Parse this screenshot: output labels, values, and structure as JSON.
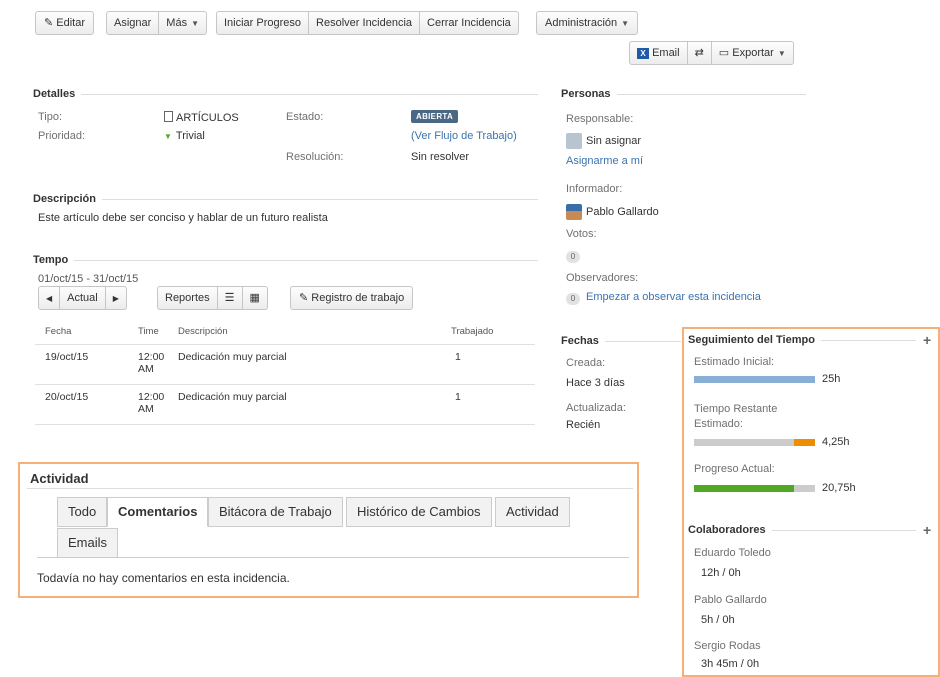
{
  "toolbar": {
    "edit": "Editar",
    "assign": "Asignar",
    "more": "Más",
    "start_progress": "Iniciar Progreso",
    "resolve": "Resolver Incidencia",
    "close": "Cerrar Incidencia",
    "admin": "Administración",
    "email": "Email",
    "export": "Exportar"
  },
  "details": {
    "title": "Detalles",
    "type_label": "Tipo:",
    "type_value": "ARTÍCULOS",
    "priority_label": "Prioridad:",
    "priority_value": "Trivial",
    "status_label": "Estado:",
    "status_value": "ABIERTA",
    "workflow_link": "(Ver Flujo de Trabajo)",
    "resolution_label": "Resolución:",
    "resolution_value": "Sin resolver"
  },
  "description": {
    "title": "Descripción",
    "text": "Este artículo debe ser conciso y hablar de un futuro realista"
  },
  "time": {
    "title": "Tempo",
    "range": "01/oct/15 - 31/oct/15",
    "current": "Actual",
    "reports": "Reportes",
    "worklog_button": "Registro de trabajo",
    "headers": [
      "Fecha",
      "Time",
      "Descripción",
      "Trabajado"
    ],
    "rows": [
      {
        "date": "19/oct/15",
        "time": "12:00 AM",
        "desc": "Dedicación muy parcial",
        "worked": "1"
      },
      {
        "date": "20/oct/15",
        "time": "12:00 AM",
        "desc": "Dedicación muy parcial",
        "worked": "1"
      }
    ]
  },
  "people": {
    "title": "Personas",
    "assignee_label": "Responsable:",
    "assignee_value": "Sin asignar",
    "assign_me": "Asignarme a mí",
    "reporter_label": "Informador:",
    "reporter_value": "Pablo Gallardo",
    "votes_label": "Votos:",
    "votes_count": "0",
    "watchers_label": "Observadores:",
    "watchers_count": "0",
    "watch_link": "Empezar a observar esta incidencia"
  },
  "dates": {
    "title": "Fechas",
    "created_label": "Creada:",
    "created_value": "Hace 3 días",
    "updated_label": "Actualizada:",
    "updated_value": "Recién"
  },
  "time_tracking": {
    "title": "Seguimiento del Tiempo",
    "estimated_label": "Estimado Inicial:",
    "estimated_value": "25h",
    "estimated_fraction": 1.0,
    "remaining_label_1": "Tiempo Restante",
    "remaining_label_2": "Estimado:",
    "remaining_value": "4,25h",
    "remaining_fraction": 0.17,
    "logged_label": "Progreso Actual:",
    "logged_value": "20,75h",
    "logged_fraction": 0.83,
    "colors": {
      "estimated": "#89afd7",
      "remaining": "#ec8e00",
      "logged": "#51a825",
      "track": "#cccccc"
    }
  },
  "collaborators": {
    "title": "Colaboradores",
    "items": [
      {
        "name": "Eduardo Toledo",
        "time": "12h / 0h"
      },
      {
        "name": "Pablo Gallardo",
        "time": "5h / 0h"
      },
      {
        "name": "Sergio Rodas",
        "time": "3h 45m / 0h"
      }
    ]
  },
  "activity": {
    "title": "Actividad",
    "tabs": [
      "Todo",
      "Comentarios",
      "Bitácora de Trabajo",
      "Histórico de Cambios",
      "Actividad",
      "Emails"
    ],
    "active_tab": "Comentarios",
    "empty_message": "Todavía no hay comentarios en esta incidencia."
  }
}
